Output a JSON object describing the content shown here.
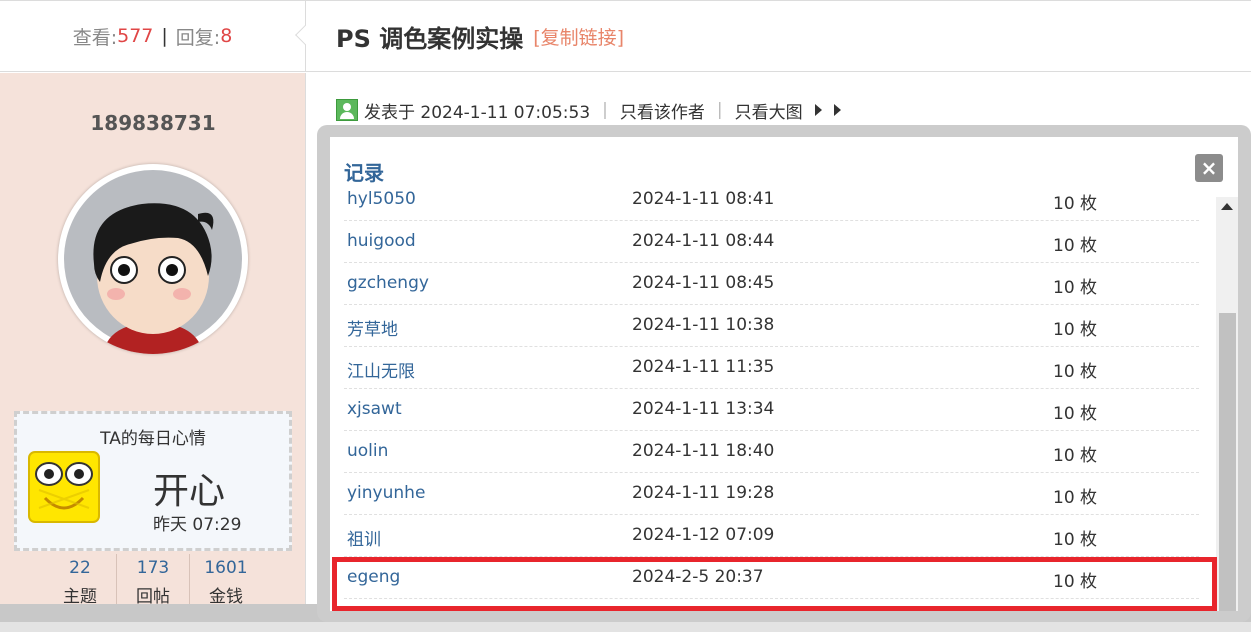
{
  "stats": {
    "view_label": "查看:",
    "view_count": "577",
    "separator": "|",
    "reply_label": "回复:",
    "reply_count": "8"
  },
  "thread": {
    "title": "PS 调色案例实操",
    "copy_link": "[复制链接]"
  },
  "post_meta": {
    "posted_at": "发表于 2024-1-11 07:05:53",
    "sep": "|",
    "author_only": "只看该作者",
    "big_image": "只看大图"
  },
  "sidebar": {
    "username": "189838731",
    "mood": {
      "title": "TA的每日心情",
      "text": "开心",
      "time": "昨天 07:29"
    },
    "user_stats": [
      {
        "value": "22",
        "label": "主题"
      },
      {
        "value": "173",
        "label": "回帖"
      },
      {
        "value": "1601",
        "label": "金钱"
      }
    ]
  },
  "modal": {
    "title": "记录",
    "close": "×",
    "rows": [
      {
        "name": "hyl5050",
        "time": "2024-1-11 08:41",
        "amount": "10 枚"
      },
      {
        "name": "huigood",
        "time": "2024-1-11 08:44",
        "amount": "10 枚"
      },
      {
        "name": "gzchengy",
        "time": "2024-1-11 08:45",
        "amount": "10 枚"
      },
      {
        "name": "芳草地",
        "time": "2024-1-11 10:38",
        "amount": "10 枚"
      },
      {
        "name": "江山无限",
        "time": "2024-1-11 11:35",
        "amount": "10 枚"
      },
      {
        "name": "xjsawt",
        "time": "2024-1-11 13:34",
        "amount": "10 枚"
      },
      {
        "name": "uolin",
        "time": "2024-1-11 18:40",
        "amount": "10 枚"
      },
      {
        "name": "yinyunhe",
        "time": "2024-1-11 19:28",
        "amount": "10 枚"
      },
      {
        "name": "祖训",
        "time": "2024-1-12 07:09",
        "amount": "10 枚"
      },
      {
        "name": "egeng",
        "time": "2024-2-5 20:37",
        "amount": "10 枚"
      }
    ]
  },
  "colors": {
    "link_blue": "#336699",
    "count_red": "#e04646",
    "sidebar_bg": "#f5e2da",
    "highlight_red": "#e8252c"
  }
}
